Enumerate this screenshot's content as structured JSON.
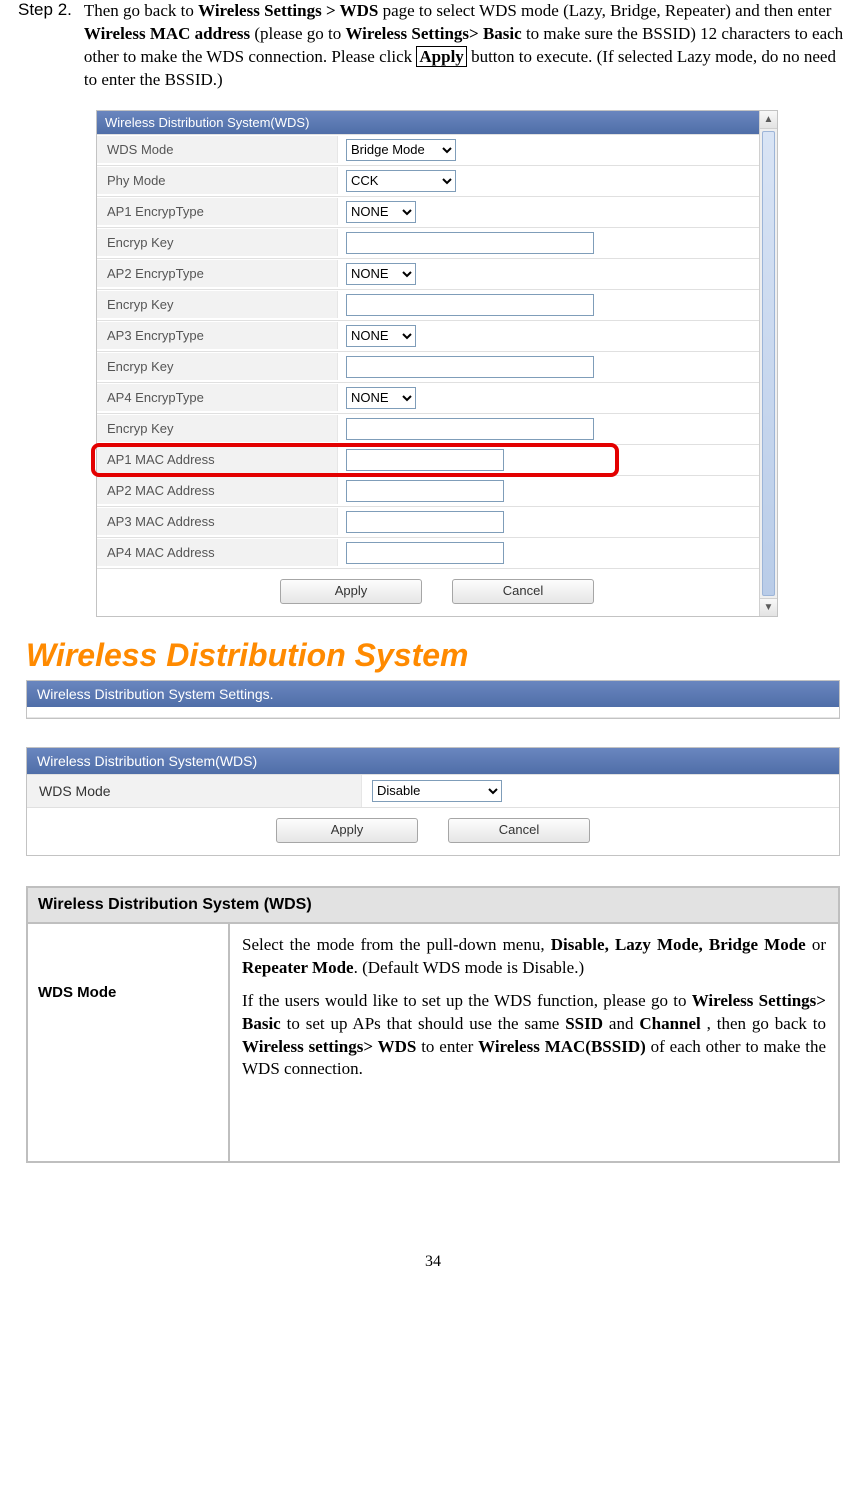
{
  "step": {
    "label": "Step 2.",
    "text_pre": "Then go back to ",
    "b1": "Wireless Settings > WDS",
    "text2": " page to select WDS mode (Lazy, Bridge, Repeater) and then enter ",
    "b2": "Wireless MAC address",
    "text3": " (please go to ",
    "b3": "Wireless Settings> Basic",
    "text4": " to make sure the BSSID) 12 characters to each other to make the WDS connection. Please click ",
    "apply": "Apply",
    "text5": " button to execute. (If selected Lazy mode, do no need to enter the BSSID.)"
  },
  "panel1": {
    "header": "Wireless Distribution System(WDS)",
    "wds_mode": {
      "label": "WDS Mode",
      "value": "Bridge Mode"
    },
    "phy_mode": {
      "label": "Phy Mode",
      "value": "CCK"
    },
    "ap1_enc": {
      "label": "AP1 EncrypType",
      "value": "NONE"
    },
    "ek1": {
      "label": "Encryp Key"
    },
    "ap2_enc": {
      "label": "AP2 EncrypType",
      "value": "NONE"
    },
    "ek2": {
      "label": "Encryp Key"
    },
    "ap3_enc": {
      "label": "AP3 EncrypType",
      "value": "NONE"
    },
    "ek3": {
      "label": "Encryp Key"
    },
    "ap4_enc": {
      "label": "AP4 EncrypType",
      "value": "NONE"
    },
    "ek4": {
      "label": "Encryp Key"
    },
    "ap1_mac": {
      "label": "AP1 MAC Address"
    },
    "ap2_mac": {
      "label": "AP2 MAC Address"
    },
    "ap3_mac": {
      "label": "AP3 MAC Address"
    },
    "ap4_mac": {
      "label": "AP4 MAC Address"
    },
    "apply": "Apply",
    "cancel": "Cancel"
  },
  "section2": {
    "title": "Wireless Distribution System",
    "settings_header": "Wireless Distribution System Settings.",
    "wds_header": "Wireless Distribution System(WDS)",
    "wds_mode_label": "WDS Mode",
    "wds_mode_value": "Disable",
    "apply": "Apply",
    "cancel": "Cancel"
  },
  "desc": {
    "header": "Wireless Distribution System (WDS)",
    "left": "WDS Mode",
    "p1_pre": "Select the mode from the pull-down menu, ",
    "p1_b1": "Disable, Lazy Mode, Bridge Mode",
    "p1_mid": " or ",
    "p1_b2": "Repeater Mode",
    "p1_post": ". (Default WDS mode is Disable.)",
    "p2_pre": "If the users would like to set up the WDS function, please go to ",
    "p2_b1": "Wireless Settings> Basic",
    "p2_mid1": " to set up APs that should use the same ",
    "p2_b2": "SSID",
    "p2_mid2": " and ",
    "p2_b3": "Channel",
    "p2_mid3": " , then go back to ",
    "p2_b4": "Wireless settings> WDS",
    "p2_mid4": " to enter ",
    "p2_b5": "Wireless MAC(BSSID)",
    "p2_post": " of each other to make the WDS connection."
  },
  "page_number": "34"
}
